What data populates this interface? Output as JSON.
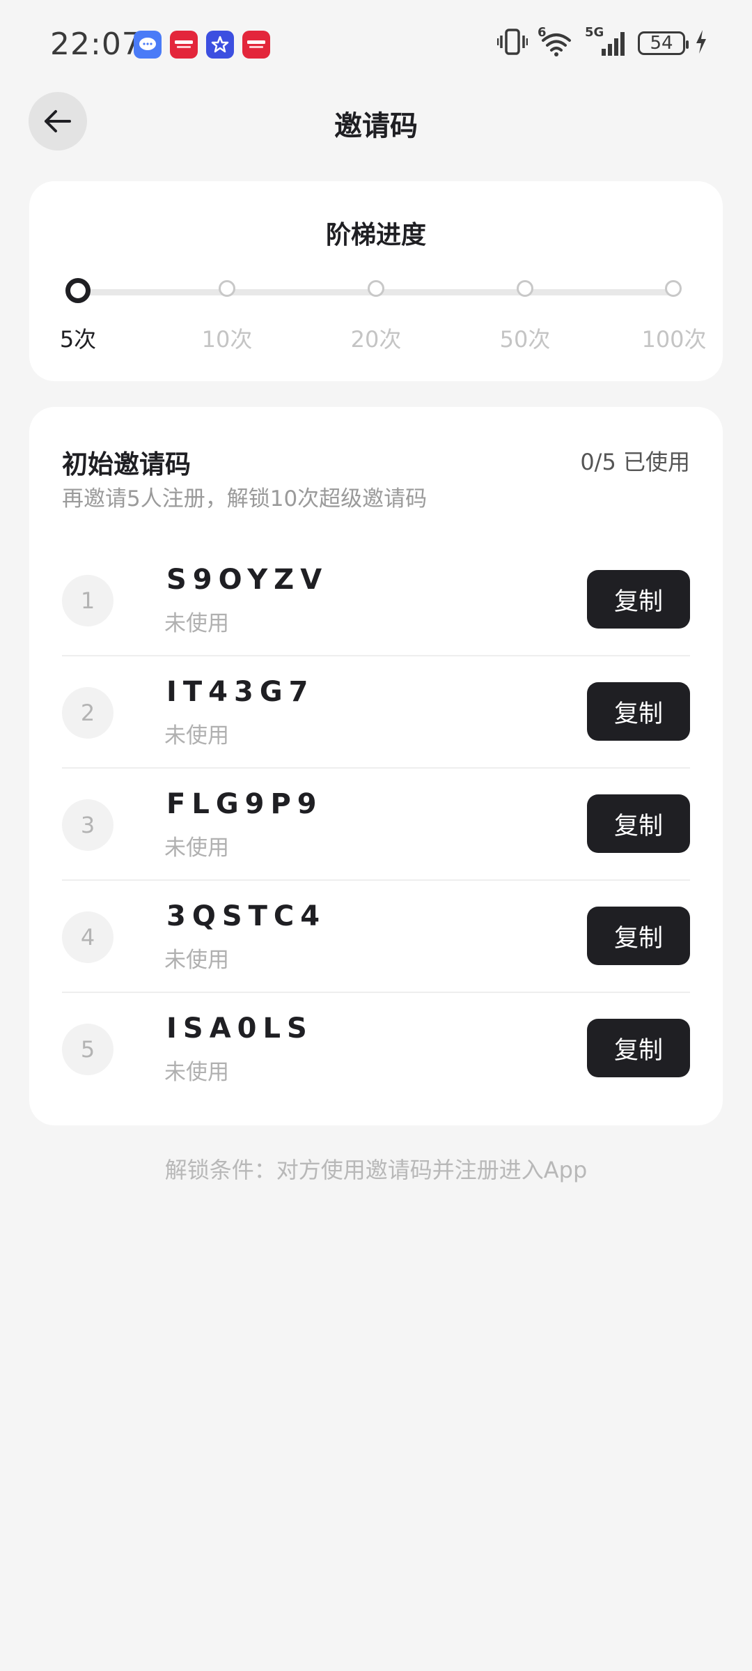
{
  "status_bar": {
    "time": "22:07",
    "battery_level": "54",
    "network_label": "5G",
    "wifi_label": "6",
    "notification_icons": [
      "message-icon",
      "xiaohongshu-icon",
      "star-app-icon",
      "xiaohongshu-icon"
    ]
  },
  "header": {
    "title": "邀请码",
    "back_icon": "arrow-left-icon"
  },
  "progress": {
    "title": "阶梯进度",
    "current_step": 0,
    "steps": [
      {
        "label": "5次"
      },
      {
        "label": "10次"
      },
      {
        "label": "20次"
      },
      {
        "label": "50次"
      },
      {
        "label": "100次"
      }
    ]
  },
  "codes": {
    "title": "初始邀请码",
    "usage": "0/5 已使用",
    "subtitle": "再邀请5人注册，解锁10次超级邀请码",
    "items": [
      {
        "index": "1",
        "code": "S9OYZV",
        "status": "未使用",
        "action": "复制"
      },
      {
        "index": "2",
        "code": "IT43G7",
        "status": "未使用",
        "action": "复制"
      },
      {
        "index": "3",
        "code": "FLG9P9",
        "status": "未使用",
        "action": "复制"
      },
      {
        "index": "4",
        "code": "3QSTC4",
        "status": "未使用",
        "action": "复制"
      },
      {
        "index": "5",
        "code": "ISA0LS",
        "status": "未使用",
        "action": "复制"
      }
    ]
  },
  "footer": {
    "note": "解锁条件：对方使用邀请码并注册进入App"
  },
  "colors": {
    "background": "#f5f5f5",
    "card": "#ffffff",
    "primary_dark": "#1f1f23",
    "muted_text": "#b0b0b0"
  }
}
